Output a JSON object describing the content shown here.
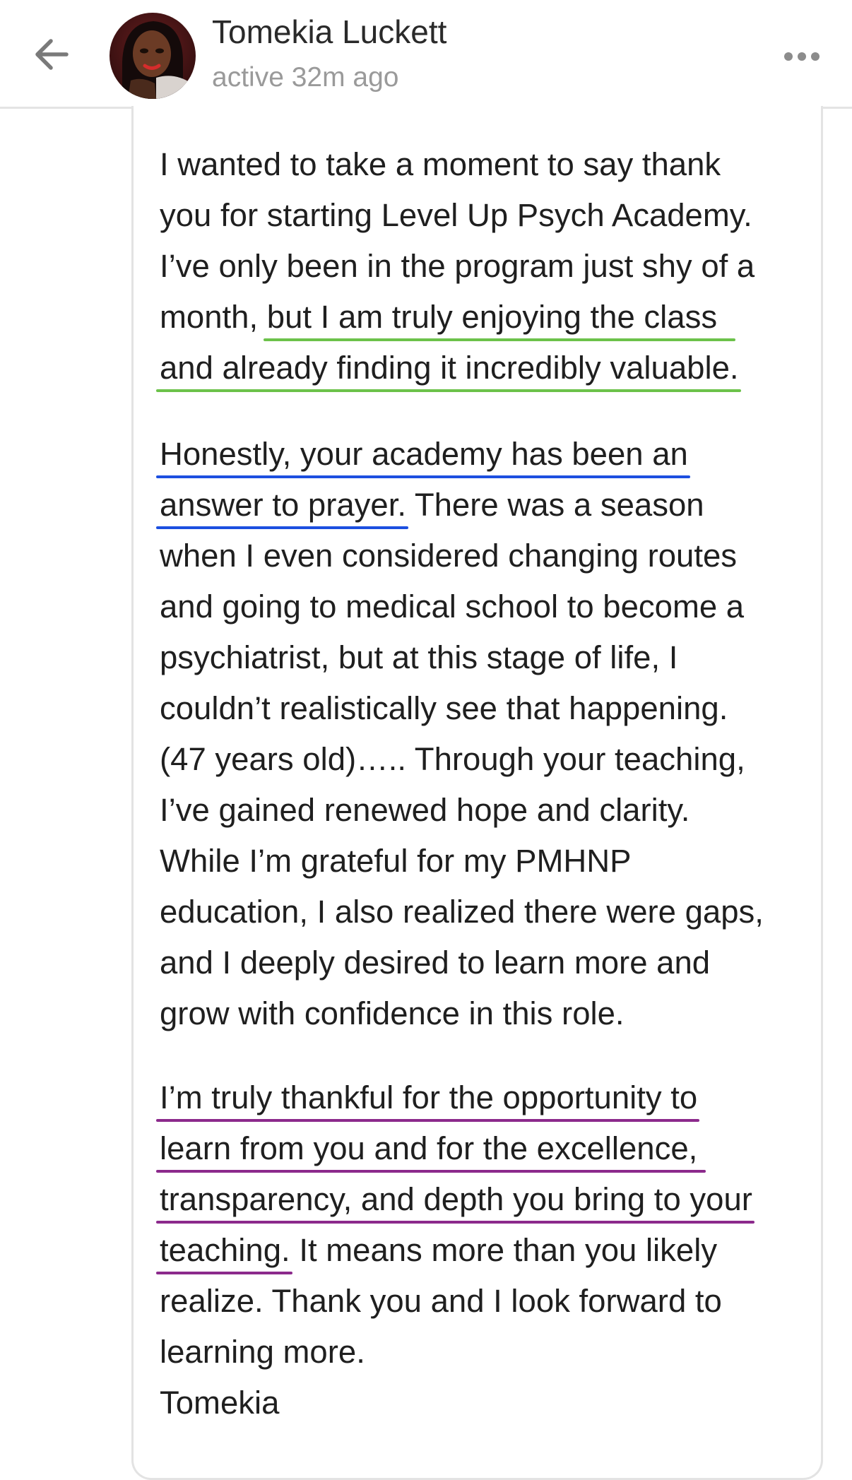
{
  "header": {
    "back_icon": "arrow-left-icon",
    "user_name": "Tomekia Luckett",
    "status": "active 32m ago",
    "more_icon": "more-horizontal-icon"
  },
  "message": {
    "para1": [
      "I wanted to take a moment to say thank",
      "you for starting Level Up Psych Academy.",
      "I’ve only been in the program just shy of a",
      "month,",
      "but I am truly enjoying the class",
      "and already finding it incredibly valuable."
    ],
    "para2": [
      "Honestly, your academy has been an",
      "answer to prayer.",
      " There was a season",
      "when I even considered changing routes",
      "and going to medical school to become a",
      "psychiatrist, but at this stage of life, I",
      "couldn’t realistically see that happening.",
      "(47 years old)….. Through your teaching,",
      "I’ve gained renewed hope and clarity.",
      "While I’m grateful for my PMHNP",
      "education, I also realized there were gaps,",
      "and I deeply desired to learn more and",
      "grow with confidence in this role."
    ],
    "para3": [
      "I’m truly thankful for the opportunity to",
      "learn from you and for the excellence,",
      "transparency, and depth you bring to your",
      "teaching.",
      " It means more than you likely",
      "realize. Thank you and I look forward to",
      "learning more.",
      "Tomekia"
    ]
  },
  "highlight_colors": {
    "green": "#6cc24a",
    "blue": "#1c4fe0",
    "purple": "#8c2a8c"
  }
}
